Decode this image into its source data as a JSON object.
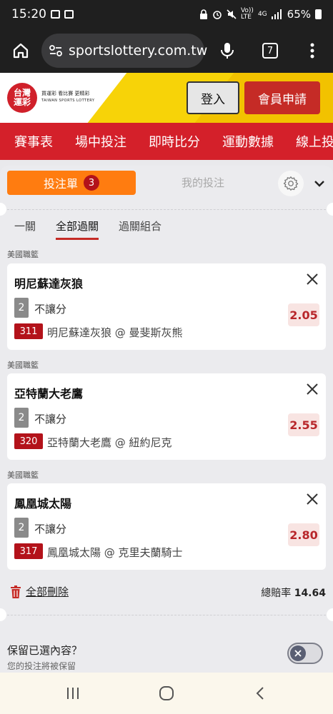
{
  "status_bar": {
    "time": "15:20",
    "battery": "65%",
    "volte": "Vo))\nLTE",
    "network": "4G"
  },
  "browser": {
    "url": "sportslottery.com.tw",
    "tab_count": "7"
  },
  "site": {
    "logo_text": "台灣\n運彩",
    "logo_tagline": "買運彩 看比賽 更精彩",
    "logo_en": "TAIWAN SPORTS LOTTERY",
    "login_label": "登入",
    "register_label": "會員申請"
  },
  "nav": {
    "items": [
      "賽事表",
      "場中投注",
      "即時比分",
      "運動數據",
      "線上投"
    ]
  },
  "betslip": {
    "tab_label": "投注單",
    "count": "3",
    "mybets_label": "我的投注",
    "subtabs": [
      "一關",
      "全部過關",
      "過關組合"
    ],
    "bets": [
      {
        "league": "美國職籃",
        "team": "明尼蘇達灰狼",
        "market_no": "2",
        "market": "不讓分",
        "game_no": "311",
        "match": "明尼蘇達灰狼 @ 曼斐斯灰熊",
        "odds": "2.05"
      },
      {
        "league": "美國職籃",
        "team": "亞特蘭大老鷹",
        "market_no": "2",
        "market": "不讓分",
        "game_no": "320",
        "match": "亞特蘭大老鷹 @ 紐約尼克",
        "odds": "2.55"
      },
      {
        "league": "美國職籃",
        "team": "鳳凰城太陽",
        "market_no": "2",
        "market": "不讓分",
        "game_no": "317",
        "match": "鳳凰城太陽 @ 克里夫蘭騎士",
        "odds": "2.80"
      }
    ],
    "delete_all": "全部刪除",
    "total_odds_label": "總賠率",
    "total_odds": "14.64",
    "keep_title": "保留已選內容？",
    "keep_sub": "您的投注將被保留"
  },
  "colors": {
    "brand_red": "#d4202a",
    "orange": "#ff7c10",
    "odds_red": "#b8262a"
  }
}
